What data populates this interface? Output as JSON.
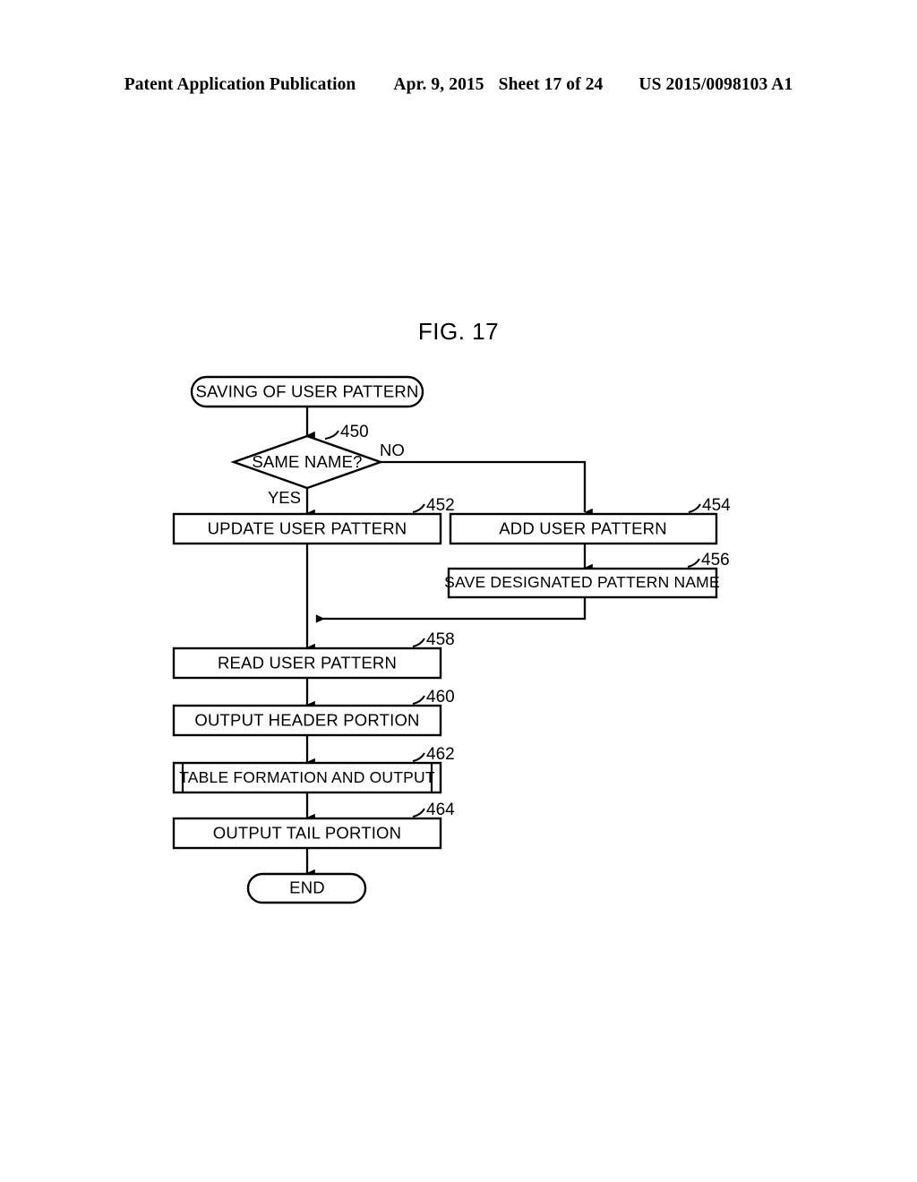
{
  "header": {
    "title": "Patent Application Publication",
    "date": "Apr. 9, 2015",
    "sheet": "Sheet 17 of 24",
    "publication_number": "US 2015/0098103 A1"
  },
  "figure": {
    "title": "FIG. 17",
    "colors": {
      "ink": "#000000",
      "paper": "#ffffff"
    }
  },
  "chart_data": {
    "type": "diagram",
    "diagram_kind": "flowchart",
    "title": "FIG. 17",
    "nodes": [
      {
        "id": "start",
        "label": "SAVING OF USER PATTERN",
        "shape": "stadium",
        "ref": ""
      },
      {
        "id": "d450",
        "label": "SAME NAME?",
        "shape": "diamond",
        "ref": "450"
      },
      {
        "id": "p452",
        "label": "UPDATE USER PATTERN",
        "shape": "rect",
        "ref": "452"
      },
      {
        "id": "p454",
        "label": "ADD USER PATTERN",
        "shape": "rect",
        "ref": "454"
      },
      {
        "id": "p456",
        "label": "SAVE DESIGNATED PATTERN NAME",
        "shape": "rect",
        "ref": "456"
      },
      {
        "id": "p458",
        "label": "READ USER PATTERN",
        "shape": "rect",
        "ref": "458"
      },
      {
        "id": "p460",
        "label": "OUTPUT HEADER PORTION",
        "shape": "rect",
        "ref": "460"
      },
      {
        "id": "p462",
        "label": "TABLE FORMATION AND OUTPUT",
        "shape": "subroutine",
        "ref": "462"
      },
      {
        "id": "p464",
        "label": "OUTPUT TAIL PORTION",
        "shape": "rect",
        "ref": "464"
      },
      {
        "id": "end",
        "label": "END",
        "shape": "stadium",
        "ref": ""
      }
    ],
    "edges": [
      {
        "from": "start",
        "to": "d450",
        "label": ""
      },
      {
        "from": "d450",
        "to": "p452",
        "label": "YES"
      },
      {
        "from": "d450",
        "to": "p454",
        "label": "NO"
      },
      {
        "from": "p454",
        "to": "p456",
        "label": ""
      },
      {
        "from": "p456",
        "to": "p458",
        "label": ""
      },
      {
        "from": "p452",
        "to": "p458",
        "label": ""
      },
      {
        "from": "p458",
        "to": "p460",
        "label": ""
      },
      {
        "from": "p460",
        "to": "p462",
        "label": ""
      },
      {
        "from": "p462",
        "to": "p464",
        "label": ""
      },
      {
        "from": "p464",
        "to": "end",
        "label": ""
      }
    ],
    "branch_labels": {
      "yes": "YES",
      "no": "NO"
    }
  }
}
